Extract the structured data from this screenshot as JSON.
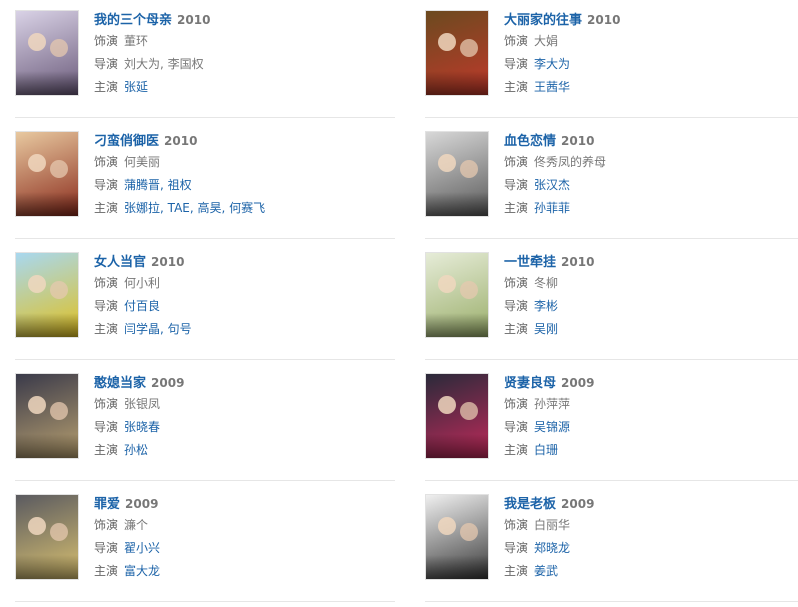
{
  "labels": {
    "role": "饰演",
    "director": "导演",
    "starring": "主演"
  },
  "colors": {
    "link": "#1c63a8",
    "year": "#777777",
    "divider": "#e6e6e6"
  },
  "items": [
    {
      "title": "我的三个母亲",
      "year": "2010",
      "role": "董环",
      "directors": [
        "刘大为",
        "李国权"
      ],
      "directors_linked": false,
      "stars": [
        "张延"
      ],
      "poster_colors": [
        "#d9d2e6",
        "#6a5a7a"
      ]
    },
    {
      "title": "大丽家的往事",
      "year": "2010",
      "role": "大娟",
      "directors": [
        "李大为"
      ],
      "directors_linked": true,
      "stars": [
        "王茜华"
      ],
      "poster_colors": [
        "#6b4a1f",
        "#c0392b"
      ]
    },
    {
      "title": "刁蛮俏御医",
      "year": "2010",
      "role": "何美丽",
      "directors": [
        "蒲腾晋",
        "祖权"
      ],
      "directors_linked": true,
      "stars": [
        "张娜拉",
        "TAE",
        "高昊",
        "何赛飞"
      ],
      "poster_colors": [
        "#e8c9a0",
        "#8a2b1c"
      ]
    },
    {
      "title": "血色恋情",
      "year": "2010",
      "role": "佟秀凤的养母",
      "directors": [
        "张汉杰"
      ],
      "directors_linked": true,
      "stars": [
        "孙菲菲"
      ],
      "poster_colors": [
        "#d8d8d8",
        "#5a5a5a"
      ]
    },
    {
      "title": "女人当官",
      "year": "2010",
      "role": "何小利",
      "directors": [
        "付百良"
      ],
      "directors_linked": true,
      "stars": [
        "闫学晶",
        "句号"
      ],
      "poster_colors": [
        "#a8d8f0",
        "#e0c020"
      ]
    },
    {
      "title": "一世牵挂",
      "year": "2010",
      "role": "冬柳",
      "directors": [
        "李彬"
      ],
      "directors_linked": true,
      "stars": [
        "吴刚"
      ],
      "poster_colors": [
        "#e6ecd8",
        "#9aae6a"
      ]
    },
    {
      "title": "憨媳当家",
      "year": "2009",
      "role": "张银凤",
      "directors": [
        "张晓春"
      ],
      "directors_linked": true,
      "stars": [
        "孙松"
      ],
      "poster_colors": [
        "#3a3a4a",
        "#b8a070"
      ]
    },
    {
      "title": "贤妻良母",
      "year": "2009",
      "role": "孙萍萍",
      "directors": [
        "吴锦源"
      ],
      "directors_linked": true,
      "stars": [
        "白珊"
      ],
      "poster_colors": [
        "#2a2a3a",
        "#c02a5a"
      ]
    },
    {
      "title": "罪爱",
      "year": "2009",
      "role": "濂个",
      "directors": [
        "翟小兴"
      ],
      "directors_linked": true,
      "stars": [
        "富大龙"
      ],
      "poster_colors": [
        "#5a5a60",
        "#d8c070"
      ]
    },
    {
      "title": "我是老板",
      "year": "2009",
      "role": "白丽华",
      "directors": [
        "郑晓龙"
      ],
      "directors_linked": true,
      "stars": [
        "姜武"
      ],
      "poster_colors": [
        "#f0f0f0",
        "#3a3a3a"
      ]
    }
  ]
}
